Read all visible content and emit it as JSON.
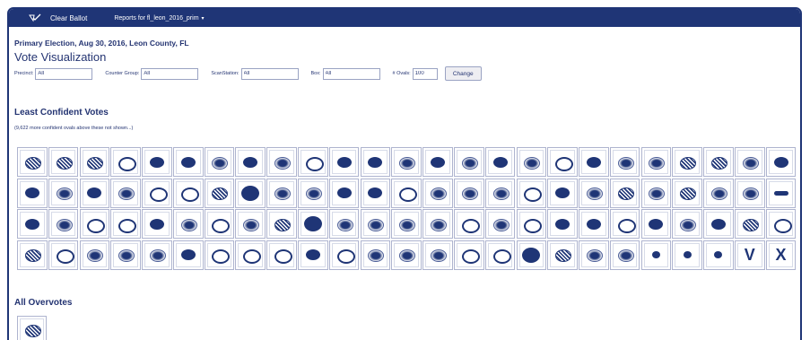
{
  "navbar": {
    "brand": "Clear Ballot",
    "reports_label": "Reports for fl_leon_2016_prim",
    "caret": "▾",
    "logo_icon": "ballot-check-icon"
  },
  "header": {
    "election": "Primary Election, Aug 30, 2016, Leon County, FL",
    "page_title": "Vote Visualization"
  },
  "filters": {
    "precinct": {
      "label": "Precinct:",
      "value": "All"
    },
    "counter_group": {
      "label": "Counter Group:",
      "value": "All"
    },
    "scan_station": {
      "label": "ScanStation:",
      "value": "All"
    },
    "box": {
      "label": "Box:",
      "value": "All"
    },
    "ovals": {
      "label": "# Ovals:",
      "value": "100"
    },
    "change_label": "Change"
  },
  "least_confident": {
    "title": "Least Confident Votes",
    "note": "(9,622 more confident ovals above these not shown...)",
    "rows": 4,
    "columns": 25,
    "oval_count": 100,
    "oval_styles": [
      "scribble",
      "scribble",
      "scribble",
      "ring",
      "solid",
      "solid",
      "light",
      "solid",
      "light",
      "ring",
      "solid",
      "solid",
      "light",
      "solid",
      "light",
      "solid",
      "light",
      "ring",
      "solid",
      "light",
      "light",
      "scribble",
      "scribble",
      "light",
      "solid",
      "solid",
      "light",
      "solid",
      "light",
      "ring",
      "ring",
      "scribble",
      "big",
      "light",
      "light",
      "solid",
      "solid",
      "ring",
      "light",
      "light",
      "light",
      "ring",
      "solid",
      "light",
      "scribble",
      "light",
      "scribble",
      "light",
      "light",
      "dash",
      "solid",
      "light",
      "ring",
      "ring",
      "solid",
      "light",
      "ring",
      "light",
      "scribble",
      "big",
      "light",
      "light",
      "light",
      "light",
      "ring",
      "light",
      "ring",
      "solid",
      "solid",
      "ring",
      "solid",
      "light",
      "solid",
      "scribble",
      "ring",
      "scribble",
      "ring",
      "light",
      "light",
      "light",
      "solid",
      "ring",
      "ring",
      "ring",
      "solid",
      "ring",
      "light",
      "light",
      "light",
      "ring",
      "ring",
      "big",
      "scribble",
      "light",
      "light",
      "small",
      "small",
      "small",
      "mark-v",
      "mark-x"
    ],
    "marks": {
      "mark-v": "V",
      "mark-x": "X"
    }
  },
  "overvotes": {
    "title": "All Overvotes",
    "count": 1,
    "oval_styles": [
      "scribble"
    ]
  },
  "colors": {
    "navy": "#1f3576",
    "border": "#aeb4cf"
  }
}
